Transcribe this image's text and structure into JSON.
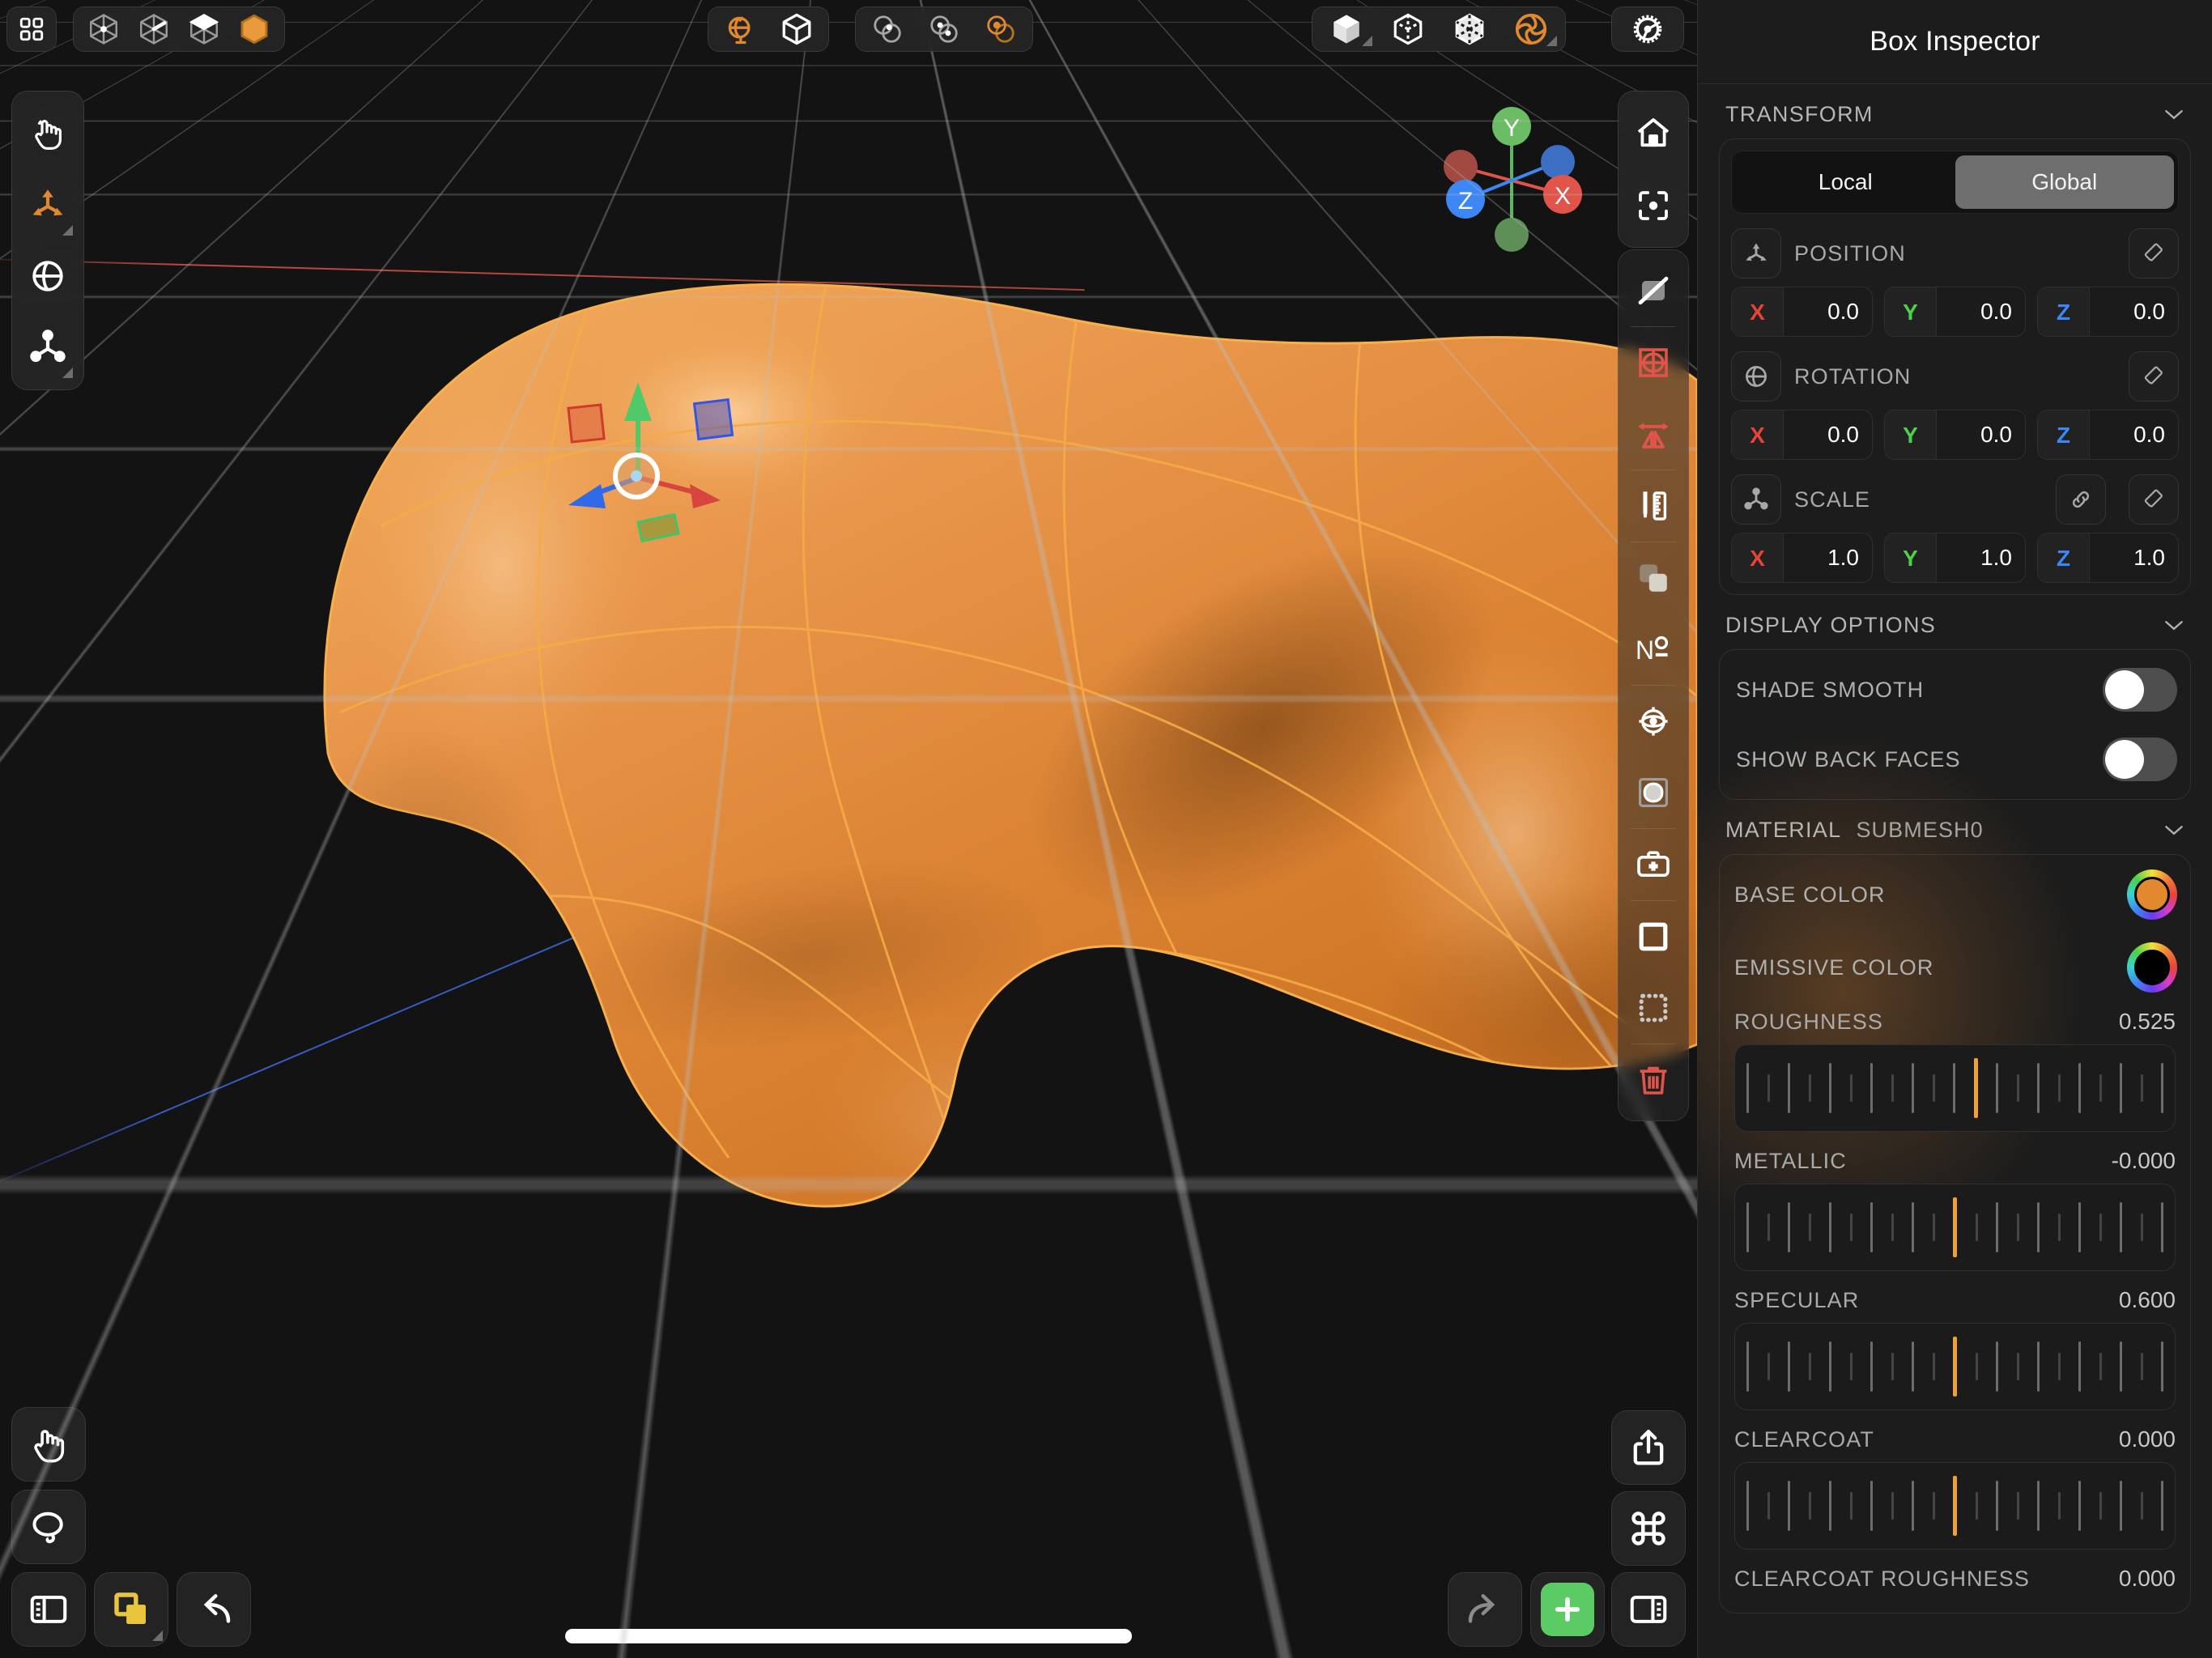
{
  "app": {
    "toolbar_top_left": [
      {
        "name": "layout-grid",
        "label": "Layout",
        "active": false
      }
    ],
    "select_modes": [
      {
        "name": "vertex-select",
        "label": "Vertex",
        "active": false
      },
      {
        "name": "edge-select",
        "label": "Edge",
        "active": false
      },
      {
        "name": "face-select",
        "label": "Face",
        "active": false
      },
      {
        "name": "object-select",
        "label": "Object",
        "active": true
      }
    ],
    "space_modes": [
      {
        "name": "world-space",
        "label": "World",
        "active": true
      },
      {
        "name": "object-space",
        "label": "Object",
        "active": false
      }
    ],
    "symmetry_modes": [
      {
        "name": "symmetry-off",
        "label": "Symmetry Off",
        "active": false
      },
      {
        "name": "symmetry-mirror",
        "label": "Mirror",
        "active": false
      },
      {
        "name": "symmetry-radial",
        "label": "Radial",
        "active": true
      }
    ],
    "shading_modes": [
      {
        "name": "shading-solid",
        "label": "Solid",
        "active": false
      },
      {
        "name": "shading-wireframe",
        "label": "Wireframe",
        "active": false
      },
      {
        "name": "shading-xray",
        "label": "X-Ray",
        "active": false
      },
      {
        "name": "shading-rendered",
        "label": "Rendered",
        "active": true
      }
    ],
    "settings_button": {
      "name": "settings-gear",
      "label": "Settings"
    },
    "left_tools": [
      {
        "name": "tool-select",
        "label": "Select",
        "active": false
      },
      {
        "name": "tool-move",
        "label": "Move",
        "active": true
      },
      {
        "name": "tool-rotate",
        "label": "Rotate",
        "active": false
      },
      {
        "name": "tool-scale",
        "label": "Scale",
        "active": false
      }
    ],
    "right_view_tools": [
      {
        "name": "home-view",
        "label": "Home View"
      },
      {
        "name": "frame-selection",
        "label": "Frame Selection"
      }
    ],
    "right_edit_tools": [
      {
        "name": "hide-texture",
        "label": "Hide Texture"
      },
      {
        "name": "subdivide",
        "label": "Subdivide"
      },
      {
        "name": "mirror",
        "label": "Mirror"
      },
      {
        "name": "measure",
        "label": "Measure"
      },
      {
        "name": "duplicate-layer",
        "label": "Duplicate"
      },
      {
        "name": "numbering",
        "label": "Numbering"
      },
      {
        "name": "pivot-orbit",
        "label": "Pivot"
      },
      {
        "name": "rounded-shape",
        "label": "Rounded Shape"
      },
      {
        "name": "repair-mesh",
        "label": "Repair Mesh"
      },
      {
        "name": "select-all",
        "label": "Select All"
      },
      {
        "name": "select-none",
        "label": "Select None"
      },
      {
        "name": "delete",
        "label": "Delete"
      }
    ],
    "bottom_left_buttons": [
      {
        "name": "pan-tool",
        "label": "Pan"
      },
      {
        "name": "lasso-select",
        "label": "Lasso Select"
      },
      {
        "name": "toggle-left-panel",
        "label": "Toggle Left Panel"
      },
      {
        "name": "duplicate-object",
        "label": "Duplicate Object"
      },
      {
        "name": "undo",
        "label": "Undo"
      }
    ],
    "bottom_right_buttons": [
      {
        "name": "share",
        "label": "Share"
      },
      {
        "name": "command-palette",
        "label": "Commands"
      },
      {
        "name": "redo",
        "label": "Redo"
      },
      {
        "name": "add-object",
        "label": "Add"
      },
      {
        "name": "toggle-right-panel",
        "label": "Toggle Right Panel"
      }
    ]
  },
  "gizmo": {
    "axes": [
      {
        "name": "axis-y",
        "label": "Y",
        "color": "#5cb85c"
      },
      {
        "name": "axis-x",
        "label": "X",
        "color": "#e0544a"
      },
      {
        "name": "axis-z",
        "label": "Z",
        "color": "#3d87f5"
      }
    ]
  },
  "inspector": {
    "title": "Box Inspector",
    "transform": {
      "heading": "TRANSFORM",
      "space": {
        "options": [
          "Local",
          "Global"
        ],
        "selected": "Global"
      },
      "rows": [
        {
          "name": "position",
          "label": "POSITION",
          "icon": "position-icon",
          "has_link": false,
          "fields": [
            {
              "axis": "X",
              "value": "0.0"
            },
            {
              "axis": "Y",
              "value": "0.0"
            },
            {
              "axis": "Z",
              "value": "0.0"
            }
          ]
        },
        {
          "name": "rotation",
          "label": "ROTATION",
          "icon": "rotation-icon",
          "has_link": false,
          "fields": [
            {
              "axis": "X",
              "value": "0.0"
            },
            {
              "axis": "Y",
              "value": "0.0"
            },
            {
              "axis": "Z",
              "value": "0.0"
            }
          ]
        },
        {
          "name": "scale",
          "label": "SCALE",
          "icon": "scale-icon",
          "has_link": true,
          "fields": [
            {
              "axis": "X",
              "value": "1.0"
            },
            {
              "axis": "Y",
              "value": "1.0"
            },
            {
              "axis": "Z",
              "value": "1.0"
            }
          ]
        }
      ]
    },
    "display_options": {
      "heading": "DISPLAY OPTIONS",
      "toggles": [
        {
          "name": "shade-smooth",
          "label": "SHADE SMOOTH",
          "on": false
        },
        {
          "name": "show-back-faces",
          "label": "SHOW BACK FACES",
          "on": false
        }
      ]
    },
    "material": {
      "heading": "MATERIAL",
      "subheading": "SUBMESH0",
      "colors": [
        {
          "name": "base-color",
          "label": "BASE COLOR",
          "value": "#e2882f"
        },
        {
          "name": "emissive-color",
          "label": "EMISSIVE COLOR",
          "value": "#000000"
        }
      ],
      "sliders": [
        {
          "name": "roughness",
          "label": "ROUGHNESS",
          "value": "0.525",
          "fraction": 0.525
        },
        {
          "name": "metallic",
          "label": "METALLIC",
          "value": "-0.000",
          "fraction": 0.5
        },
        {
          "name": "specular",
          "label": "SPECULAR",
          "value": "0.600",
          "fraction": 0.5
        },
        {
          "name": "clearcoat",
          "label": "CLEARCOAT",
          "value": "0.000",
          "fraction": 0.5
        },
        {
          "name": "clearcoat-roughness",
          "label": "CLEARCOAT ROUGHNESS",
          "value": "0.000",
          "fraction": 0.5
        }
      ]
    }
  },
  "theme": {
    "accent": "#e2882f",
    "danger": "#e0544a",
    "add": "#5bcc65",
    "duplicate": "#e8c53c",
    "panel_bg": "#1c1c1c"
  }
}
